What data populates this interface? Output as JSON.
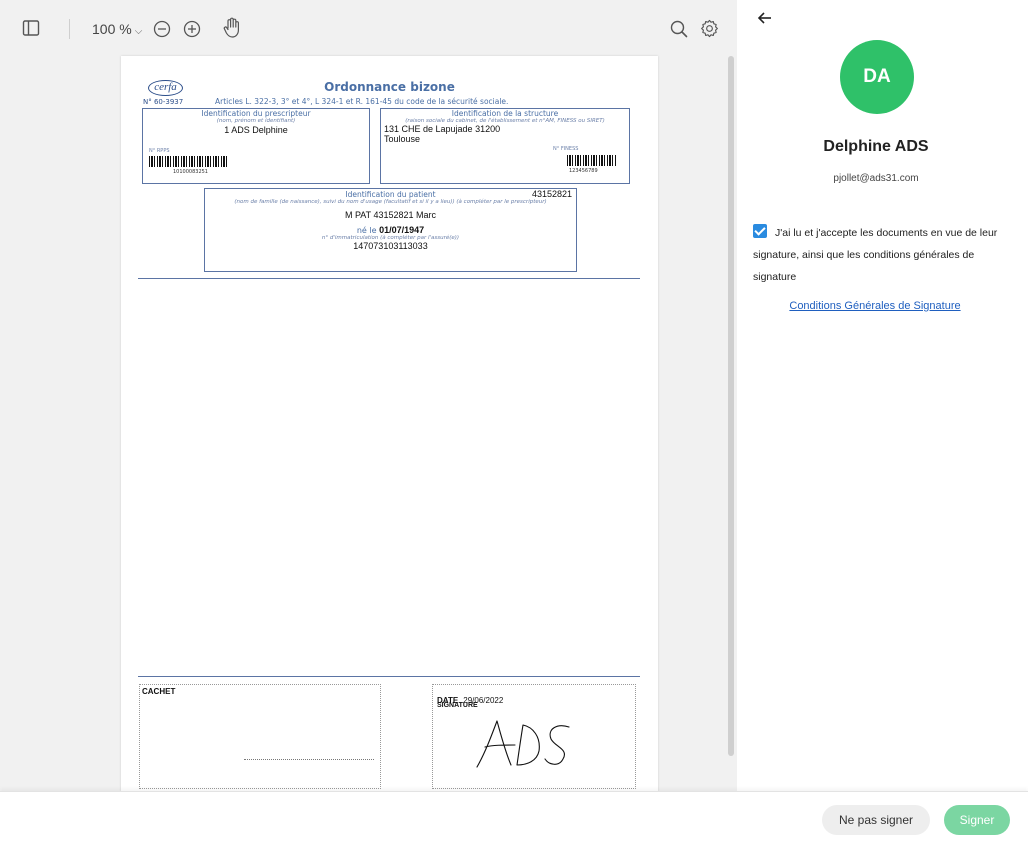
{
  "toolbar": {
    "zoom_label": "100 %",
    "icons": [
      "sidebar-toggle-icon",
      "zoom-out-icon",
      "zoom-in-icon",
      "hand-tool-icon",
      "search-icon",
      "settings-icon"
    ]
  },
  "document": {
    "logo_text": "cerfa",
    "title": "Ordonnance bizone",
    "form_number": "N° 60-3937",
    "articles": "Articles L. 322-3, 3° et 4°, L 324-1 et R. 161-45 du code de la sécurité sociale.",
    "prescriber": {
      "title": "Identification du prescripteur",
      "subtitle": "(nom, prénom et identifiant)",
      "name": "1 ADS Delphine",
      "rpps_label": "N° RPPS",
      "rpps_number": "10100083251"
    },
    "structure": {
      "title": "Identification de la structure",
      "subtitle": "(raison sociale du cabinet, de l'établissement et n°AM, FINESS ou SIRET)",
      "address_line1": "131 CHE de Lapujade 31200",
      "address_line2": "Toulouse",
      "finess_label": "N° FINESS",
      "finess_number": "123456789"
    },
    "patient": {
      "title": "Identification du patient",
      "id": "43152821",
      "subtitle": "(nom de famille (de naissance), suivi du nom d'usage (facultatif et si il y a lieu)) (à compléter par le prescripteur)",
      "name": "M PAT 43152821 Marc",
      "born_label": "né le",
      "birth_date": "01/07/1947",
      "immat_label": "n° d'immatriculation (à compléter par l'assuré(e))",
      "immat_number": "147073103113033"
    },
    "cachet_label": "CACHET",
    "date_label": "DATE",
    "date_value": "29/06/2022",
    "signature_label": "SIGNATURE"
  },
  "panel": {
    "avatar_initials": "DA",
    "user_name": "Delphine ADS",
    "user_email": "pjollet@ads31.com",
    "consent_text": "J'ai lu et j'accepte les documents en vue de leur signature, ainsi que les conditions générales de signature",
    "consent_checked": true,
    "cgs_link": "Conditions Générales de Signature"
  },
  "actions": {
    "decline_label": "Ne pas signer",
    "sign_label": "Signer"
  },
  "colors": {
    "avatar": "#2fc169",
    "sign_button": "#7bd6a2",
    "checkbox": "#2a8be0",
    "link": "#1f5fbf",
    "form_blue": "#4a6fa5"
  }
}
